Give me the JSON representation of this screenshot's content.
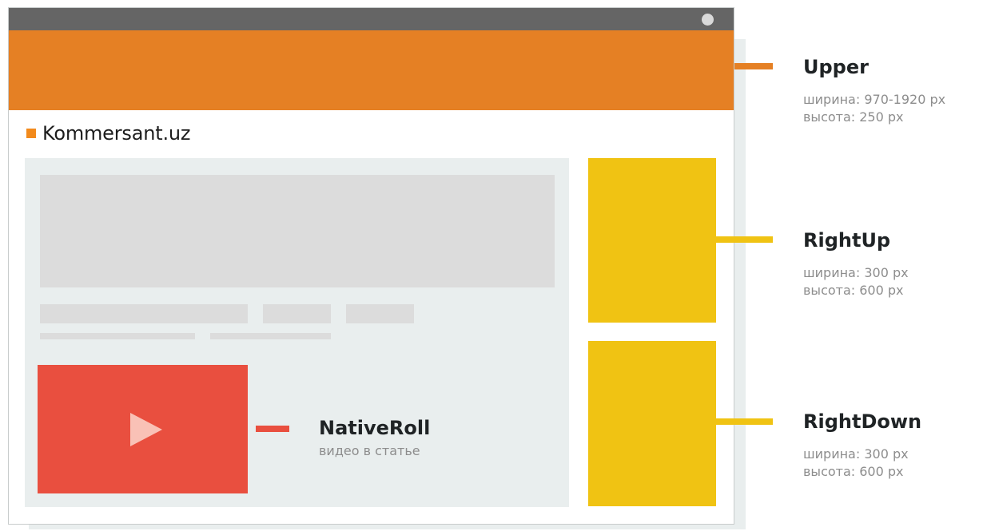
{
  "colors": {
    "titlebar": "#656565",
    "upper": "#e58024",
    "right_slots": "#f0c313",
    "native": "#e94f3f",
    "play": "#f9c1b6",
    "content_bg": "#e9eeee",
    "placeholder": "#dcdcdc",
    "logo_square": "#f28a1c"
  },
  "site": {
    "logo_text": "Kommersant.uz"
  },
  "labels": {
    "upper": {
      "title": "Upper",
      "width": "ширина: 970-1920 px",
      "height": "высота: 250 px"
    },
    "rightup": {
      "title": "RightUp",
      "width": "ширина: 300 px",
      "height": "высота: 600 px"
    },
    "rightdown": {
      "title": "RightDown",
      "width": "ширина: 300 px",
      "height": "высота: 600 px"
    },
    "nativeroll": {
      "title": "NativeRoll",
      "subtitle": "видео в статье"
    }
  },
  "icons": {
    "play": "play-icon",
    "window_dot": "window-control-dot"
  }
}
